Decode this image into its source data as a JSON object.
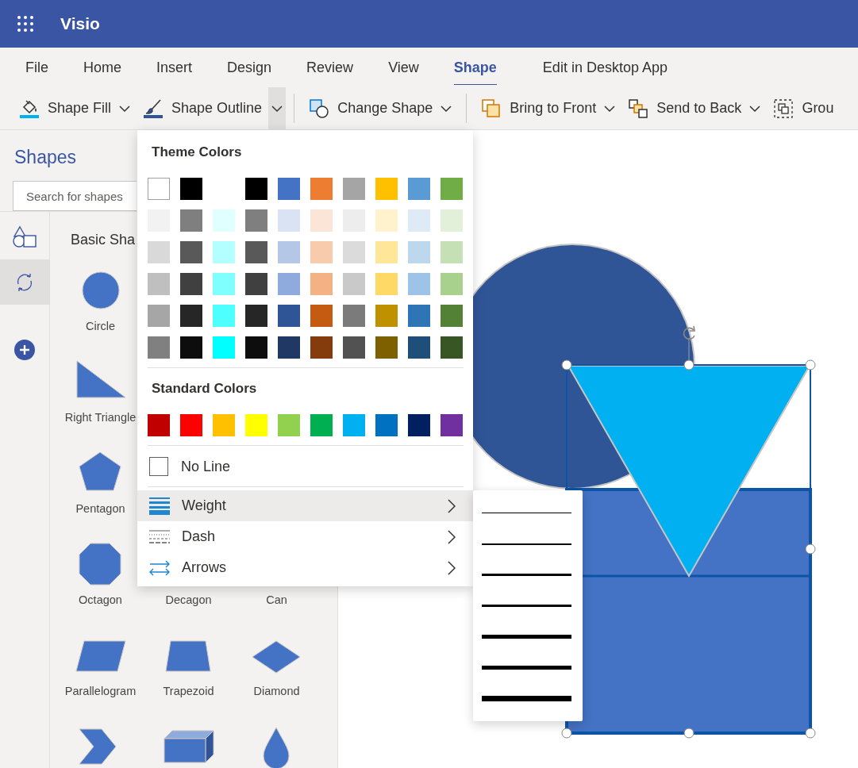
{
  "app": {
    "title": "Visio"
  },
  "ribbon_tabs": [
    {
      "label": "File",
      "selected": false
    },
    {
      "label": "Home",
      "selected": false
    },
    {
      "label": "Insert",
      "selected": false
    },
    {
      "label": "Design",
      "selected": false
    },
    {
      "label": "Review",
      "selected": false
    },
    {
      "label": "View",
      "selected": false
    },
    {
      "label": "Shape",
      "selected": true
    },
    {
      "label": "Edit in Desktop App",
      "selected": false
    }
  ],
  "toolbar": [
    {
      "kind": "fill",
      "label": "Shape Fill",
      "expanded": false,
      "separator_after": false
    },
    {
      "kind": "outline",
      "label": "Shape Outline",
      "expanded": true,
      "separator_after": true
    },
    {
      "kind": "change",
      "label": "Change Shape",
      "expanded": false,
      "separator_after": true
    },
    {
      "kind": "front",
      "label": "Bring to Front",
      "expanded": false,
      "separator_after": false
    },
    {
      "kind": "back",
      "label": "Send to Back",
      "expanded": false,
      "separator_after": false
    },
    {
      "kind": "group",
      "label": "Grou",
      "expanded": false,
      "separator_after": false
    }
  ],
  "shapes_panel": {
    "title": "Shapes",
    "search": {
      "placeholder": "Search for shapes"
    },
    "rail": [
      {
        "kind": "shapes",
        "selected": false
      },
      {
        "kind": "reshape",
        "selected": true
      },
      {
        "kind": "add",
        "selected": false
      }
    ],
    "stencil_title": "Basic Sha",
    "rows": [
      [
        {
          "kind": "circle",
          "label": "Circle"
        }
      ],
      [
        {
          "kind": "right-triangle",
          "label": "Right Triangle"
        }
      ],
      [
        {
          "kind": "pentagon",
          "label": "Pentagon"
        }
      ],
      [
        {
          "kind": "octagon",
          "label": "Octagon"
        },
        {
          "label": "Decagon"
        },
        {
          "label": "Can"
        }
      ],
      [
        {
          "kind": "parallelogram",
          "label": "Parallelogram"
        },
        {
          "kind": "trapezoid",
          "label": "Trapezoid"
        },
        {
          "kind": "diamond",
          "label": "Diamond"
        }
      ],
      [
        {
          "kind": "chevron"
        },
        {
          "kind": "box"
        },
        {
          "kind": "drop"
        }
      ]
    ]
  },
  "outline_menu": {
    "theme_title": "Theme Colors",
    "theme_rows": [
      [
        {
          "color": "#ffffff"
        },
        {
          "color": "#000000"
        },
        null,
        {
          "color": "#000000"
        },
        {
          "color": "#4472c4"
        },
        {
          "color": "#ed7d31"
        },
        {
          "color": "#a5a5a5"
        },
        {
          "color": "#ffc000"
        },
        {
          "color": "#5b9bd5"
        },
        {
          "color": "#70ad47"
        }
      ],
      [
        {
          "color": "#f2f2f2"
        },
        {
          "color": "#7f7f7f"
        },
        {
          "color": "#e0ffff"
        },
        {
          "color": "#7f7f7f"
        },
        {
          "color": "#dae3f3"
        },
        {
          "color": "#fbe5d6"
        },
        {
          "color": "#ededed"
        },
        {
          "color": "#fff2cc"
        },
        {
          "color": "#deebf7"
        },
        {
          "color": "#e2f0d9"
        }
      ],
      [
        {
          "color": "#d9d9d9"
        },
        {
          "color": "#595959"
        },
        {
          "color": "#b3ffff"
        },
        {
          "color": "#595959"
        },
        {
          "color": "#b4c7e7"
        },
        {
          "color": "#f8cbad"
        },
        {
          "color": "#dbdbdb"
        },
        {
          "color": "#ffe699"
        },
        {
          "color": "#bdd7ee"
        },
        {
          "color": "#c5e0b4"
        }
      ],
      [
        {
          "color": "#bfbfbf"
        },
        {
          "color": "#404040"
        },
        {
          "color": "#80ffff"
        },
        {
          "color": "#404040"
        },
        {
          "color": "#8faadc"
        },
        {
          "color": "#f4b183"
        },
        {
          "color": "#c9c9c9"
        },
        {
          "color": "#ffd966"
        },
        {
          "color": "#9dc3e6"
        },
        {
          "color": "#a9d18e"
        }
      ],
      [
        {
          "color": "#a6a6a6"
        },
        {
          "color": "#262626"
        },
        {
          "color": "#4dffff"
        },
        {
          "color": "#262626"
        },
        {
          "color": "#2f5597"
        },
        {
          "color": "#c55a11"
        },
        {
          "color": "#7b7b7b"
        },
        {
          "color": "#bf9000"
        },
        {
          "color": "#2e75b6"
        },
        {
          "color": "#538135"
        }
      ],
      [
        {
          "color": "#808080"
        },
        {
          "color": "#0d0d0d"
        },
        {
          "color": "#00ffff"
        },
        {
          "color": "#0d0d0d"
        },
        {
          "color": "#203864"
        },
        {
          "color": "#843c0c"
        },
        {
          "color": "#525252"
        },
        {
          "color": "#7f6000"
        },
        {
          "color": "#1f4e79"
        },
        {
          "color": "#375623"
        }
      ]
    ],
    "standard_title": "Standard Colors",
    "standard_colors": [
      {
        "color": "#c00000"
      },
      {
        "color": "#ff0000"
      },
      {
        "color": "#ffc000"
      },
      {
        "color": "#ffff00"
      },
      {
        "color": "#92d050"
      },
      {
        "color": "#00b050"
      },
      {
        "color": "#00b0f0"
      },
      {
        "color": "#0070c0"
      },
      {
        "color": "#002060"
      },
      {
        "color": "#7030a0"
      }
    ],
    "no_line": {
      "label": "No Line",
      "checked": false
    },
    "items": [
      {
        "kind": "weight",
        "label": "Weight",
        "expanded": true
      },
      {
        "kind": "dash",
        "label": "Dash",
        "expanded": false
      },
      {
        "kind": "arrows",
        "label": "Arrows",
        "expanded": false
      }
    ]
  }
}
